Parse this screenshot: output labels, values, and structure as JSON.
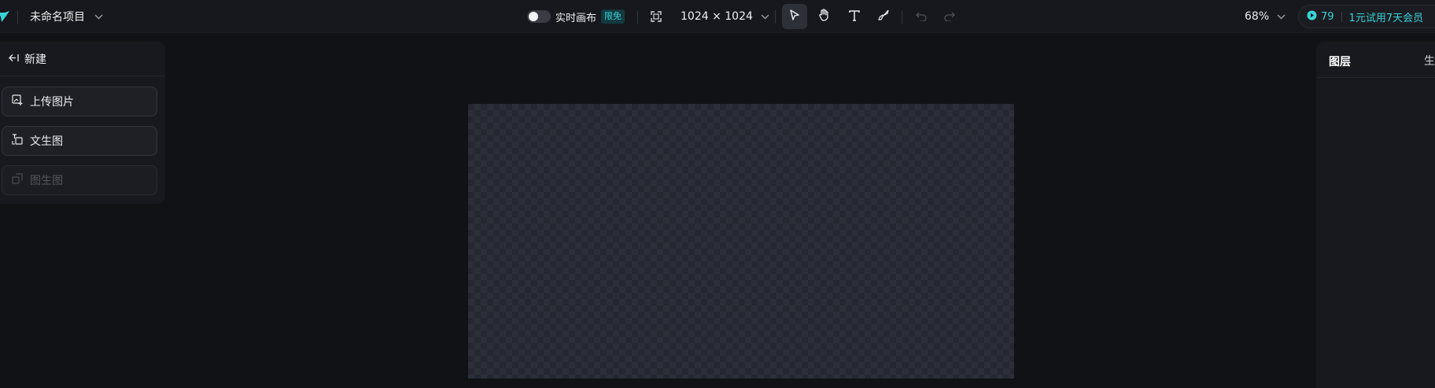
{
  "header": {
    "project_title": "未命名项目",
    "realtime_canvas_label": "实时画布",
    "limited_free_badge": "限免",
    "canvas_size_label": "1024 × 1024",
    "zoom_label": "68%",
    "points_count": "79",
    "member_promo_label": "1元试用7天会员",
    "tools": [
      "select-tool",
      "hand-tool",
      "text-tool",
      "brush-tool",
      "undo",
      "redo"
    ]
  },
  "left_panel": {
    "back_label": "新建",
    "upload_label": "上传图片",
    "text_to_image_label": "文生图",
    "image_to_image_label": "图生图"
  },
  "right_panel": {
    "tab_layers": "图层",
    "tab_generate": "生"
  },
  "colors": {
    "accent": "#38d4d6",
    "background": "#111216",
    "panel": "#18191e"
  }
}
